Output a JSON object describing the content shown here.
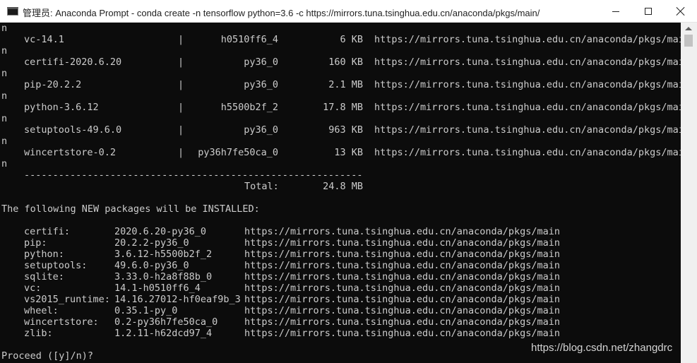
{
  "window": {
    "title": "管理员: Anaconda Prompt - conda  create -n tensorflow python=3.6 -c https://mirrors.tuna.tsinghua.edu.cn/anaconda/pkgs/main/"
  },
  "download_table": {
    "rows": [
      {
        "name": "vc-14.1",
        "build": "h0510ff6_4",
        "size": "6 KB",
        "url": "https://mirrors.tuna.tsinghua.edu.cn/anaconda/pkgs/mai"
      },
      {
        "name": "certifi-2020.6.20",
        "build": "py36_0",
        "size": "160 KB",
        "url": "https://mirrors.tuna.tsinghua.edu.cn/anaconda/pkgs/mai"
      },
      {
        "name": "pip-20.2.2",
        "build": "py36_0",
        "size": "2.1 MB",
        "url": "https://mirrors.tuna.tsinghua.edu.cn/anaconda/pkgs/mai"
      },
      {
        "name": "python-3.6.12",
        "build": "h5500b2f_2",
        "size": "17.8 MB",
        "url": "https://mirrors.tuna.tsinghua.edu.cn/anaconda/pkgs/mai"
      },
      {
        "name": "setuptools-49.6.0",
        "build": "py36_0",
        "size": "963 KB",
        "url": "https://mirrors.tuna.tsinghua.edu.cn/anaconda/pkgs/mai"
      },
      {
        "name": "wincertstore-0.2",
        "build": "py36h7fe50ca_0",
        "size": "13 KB",
        "url": "https://mirrors.tuna.tsinghua.edu.cn/anaconda/pkgs/mai"
      }
    ],
    "wrap_char": "n",
    "separator": "------------------------------------------------------------",
    "total_label": "Total:",
    "total_value": "24.8 MB"
  },
  "install_header": "The following NEW packages will be INSTALLED:",
  "install_list": [
    {
      "name": "certifi:",
      "spec": "2020.6.20-py36_0",
      "url": "https://mirrors.tuna.tsinghua.edu.cn/anaconda/pkgs/main"
    },
    {
      "name": "pip:",
      "spec": "20.2.2-py36_0",
      "url": "https://mirrors.tuna.tsinghua.edu.cn/anaconda/pkgs/main"
    },
    {
      "name": "python:",
      "spec": "3.6.12-h5500b2f_2",
      "url": "https://mirrors.tuna.tsinghua.edu.cn/anaconda/pkgs/main"
    },
    {
      "name": "setuptools:",
      "spec": "49.6.0-py36_0",
      "url": "https://mirrors.tuna.tsinghua.edu.cn/anaconda/pkgs/main"
    },
    {
      "name": "sqlite:",
      "spec": "3.33.0-h2a8f88b_0",
      "url": "https://mirrors.tuna.tsinghua.edu.cn/anaconda/pkgs/main"
    },
    {
      "name": "vc:",
      "spec": "14.1-h0510ff6_4",
      "url": "https://mirrors.tuna.tsinghua.edu.cn/anaconda/pkgs/main"
    },
    {
      "name": "vs2015_runtime:",
      "spec": "14.16.27012-hf0eaf9b_3",
      "url": "https://mirrors.tuna.tsinghua.edu.cn/anaconda/pkgs/main"
    },
    {
      "name": "wheel:",
      "spec": "0.35.1-py_0",
      "url": "https://mirrors.tuna.tsinghua.edu.cn/anaconda/pkgs/main"
    },
    {
      "name": "wincertstore:",
      "spec": "0.2-py36h7fe50ca_0",
      "url": "https://mirrors.tuna.tsinghua.edu.cn/anaconda/pkgs/main"
    },
    {
      "name": "zlib:",
      "spec": "1.2.11-h62dcd97_4",
      "url": "https://mirrors.tuna.tsinghua.edu.cn/anaconda/pkgs/main"
    }
  ],
  "prompt": "Proceed ([y]/n)?",
  "watermark": "https://blog.csdn.net/zhangdrc",
  "icons": {
    "app": "terminal-icon",
    "minimize": "minimize-icon",
    "maximize": "maximize-icon",
    "close": "close-icon"
  }
}
